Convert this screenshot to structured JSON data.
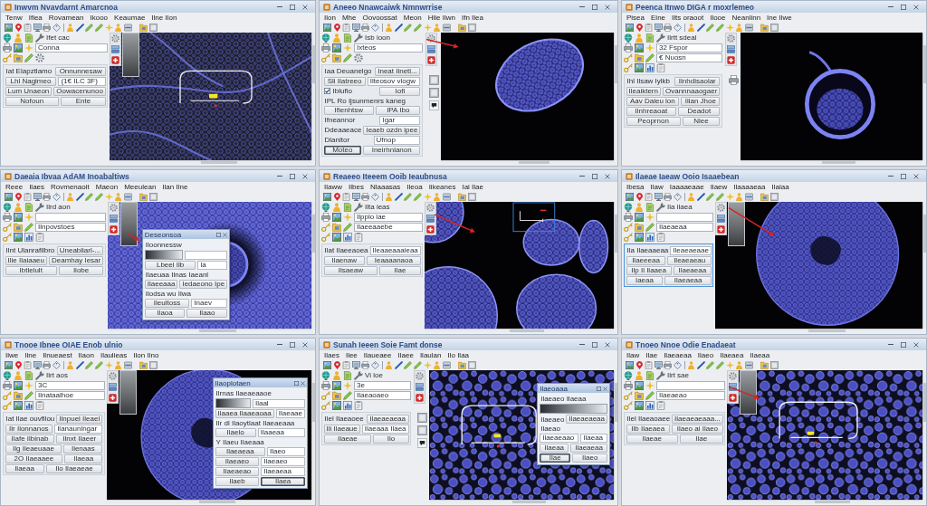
{
  "panels": [
    {
      "title": "Inwvm Nvavdarnt Amarcnoa",
      "menu": [
        "Tenw",
        "Ifiea",
        "Rovamean",
        "Ikooo",
        "Keaumae",
        "Ilne Ilon"
      ],
      "palette": [
        {
          "kind": "label",
          "text": "Ifet cac"
        },
        {
          "kind": "field",
          "value": "Conna"
        },
        {
          "kind": "plain"
        }
      ],
      "side": {
        "highlighted": false,
        "rows": [
          {
            "cells": [
              {
                "kind": "label",
                "text": "Iat Elapztlamo"
              },
              {
                "kind": "button",
                "text": "Onnunnesaw"
              }
            ]
          },
          {
            "cells": [
              {
                "kind": "button",
                "text": "Lhl Nagimeo"
              },
              {
                "kind": "field",
                "value": "(1€ ILC 3F)"
              }
            ]
          },
          {
            "cells": [
              {
                "kind": "button",
                "text": "Lum Unaeon"
              },
              {
                "kind": "button",
                "text": "Oowacenunoo"
              }
            ]
          },
          {
            "cells": [
              {
                "kind": "button",
                "text": "Nofoun"
              },
              {
                "kind": "button",
                "text": "Ente"
              }
            ]
          }
        ]
      }
    },
    {
      "title": "Aneeo Nnawcaiwk Nmnwrrise",
      "menu": [
        "Ilon",
        "Mhe",
        "Oovoossat",
        "Meon",
        "Hlie Ilwn",
        "Ifn Ilea"
      ],
      "palette": [
        {
          "kind": "label",
          "text": "Isb ioon"
        },
        {
          "kind": "field",
          "value": "Ixteos"
        },
        {
          "kind": "plain"
        }
      ],
      "side": {
        "highlighted": false,
        "rows": [
          {
            "cells": [
              {
                "kind": "label",
                "text": "Iaa Deuanelgo"
              },
              {
                "kind": "button",
                "text": "Ineat Ilnetl..."
              }
            ]
          },
          {
            "cells": [
              {
                "kind": "button",
                "text": "Sli Ilatreeo"
              },
              {
                "kind": "field",
                "value": "Ilteosov vlogw"
              }
            ]
          },
          {
            "cells": [
              {
                "kind": "check",
                "text": "Iblufio",
                "checked": true
              },
              {
                "kind": "button",
                "text": "Iofi"
              }
            ]
          },
          {
            "cells": [
              {
                "kind": "header",
                "text": "IPL Ro Ijsunmenrs kaneg"
              }
            ]
          },
          {
            "cells": [
              {
                "kind": "button",
                "text": "Ifienhtsw"
              },
              {
                "kind": "button",
                "text": "IPA Ibo"
              }
            ]
          },
          {
            "cells": [
              {
                "kind": "label",
                "text": "Ifneannor"
              },
              {
                "kind": "field",
                "value": "Igar"
              }
            ]
          },
          {
            "cells": [
              {
                "kind": "label",
                "text": "Ddeaaeace"
              },
              {
                "kind": "button",
                "text": "Ieaeb ozdn ipee"
              }
            ]
          },
          {
            "cells": [
              {
                "kind": "label",
                "text": "Dlanitor"
              },
              {
                "kind": "field",
                "value": "Ufnop"
              }
            ]
          },
          {
            "cells": [
              {
                "kind": "primary",
                "text": "Moteo"
              },
              {
                "kind": "button",
                "text": "Ineirhnlanon"
              }
            ]
          }
        ]
      }
    },
    {
      "title": "Peenca Itnwo DIGA r moxrlemeo",
      "menu": [
        "Pisea",
        "Eine",
        "Ilts oraoot",
        "Ilooe",
        "Neanlinn",
        "Ine Ilwe"
      ],
      "palette": [
        {
          "kind": "label",
          "text": "Ilrtt sdeal"
        },
        {
          "kind": "field",
          "value": "32 Fspor"
        },
        {
          "kind": "field",
          "value": "€ Nuosn"
        },
        {
          "kind": "plain"
        }
      ],
      "side": {
        "highlighted": false,
        "rows": [
          {
            "cells": [
              {
                "kind": "label",
                "text": "Ihl Ilsaw Iylkb"
              },
              {
                "kind": "button",
                "text": "Ilnhdisaolar"
              }
            ]
          },
          {
            "cells": [
              {
                "kind": "button",
                "text": "Ileaiktern"
              },
              {
                "kind": "button",
                "text": "Ovannnaaogaer"
              }
            ]
          },
          {
            "cells": [
              {
                "kind": "button",
                "text": "Aav Daleu lon"
              },
              {
                "kind": "button",
                "text": "Ilian Jhoe"
              }
            ]
          },
          {
            "cells": [
              {
                "kind": "button",
                "text": "Ilnhreaoat"
              },
              {
                "kind": "button",
                "text": "Deadot"
              }
            ]
          },
          {
            "cells": [
              {
                "kind": "button",
                "text": "Peoprnon"
              },
              {
                "kind": "button",
                "text": "Nlee"
              }
            ]
          }
        ]
      }
    },
    {
      "title": "Daeaia Ibvaa AdAM Inoabaltiws",
      "menu": [
        "Reee",
        "Ilaes",
        "Rovmenaoit",
        "Maeon",
        "Meeulean",
        "Ilan Ilne"
      ],
      "palette": [
        {
          "kind": "label",
          "text": "Ilrd aon"
        },
        {
          "kind": "field"
        },
        {
          "kind": "field",
          "value": "Ilnpovstoes"
        },
        {
          "kind": "plain"
        }
      ],
      "side": {
        "highlighted": false,
        "rows": [
          {
            "cells": [
              {
                "kind": "label",
                "text": "Ilnt Ulanrafilbro"
              },
              {
                "kind": "button",
                "text": "Uneabliarl-..."
              }
            ]
          },
          {
            "cells": [
              {
                "kind": "button",
                "text": "Ilie Ilaiaaeu"
              },
              {
                "kind": "button",
                "text": "Deamhay Iesar"
              }
            ]
          },
          {
            "cells": [
              {
                "kind": "button",
                "text": "Ibtlelult"
              },
              {
                "kind": "button",
                "text": "Ilobe"
              }
            ]
          }
        ]
      },
      "dialog": {
        "title": "Deseonsoa",
        "rows": [
          {
            "cells": [
              {
                "kind": "label",
                "text": "Iloonnessw"
              }
            ]
          },
          {
            "cells": [
              {
                "kind": "preview"
              },
              {
                "kind": "field"
              }
            ]
          },
          {
            "cells": [
              {
                "kind": "button",
                "text": "Lbeel Ilb"
              },
              {
                "kind": "field",
                "value": "la"
              }
            ]
          },
          {
            "cells": [
              {
                "kind": "label",
                "text": "Ilaeuaa Ilnas Iaeanl"
              }
            ]
          },
          {
            "cells": [
              {
                "kind": "button",
                "text": "Ilaeeaaa"
              },
              {
                "kind": "button",
                "text": "Iedaeono Ipe"
              }
            ]
          },
          {
            "cells": [
              {
                "kind": "label",
                "text": "Ilodsa wu Ilwa"
              }
            ]
          },
          {
            "cells": [
              {
                "kind": "button",
                "text": "Ileultoss"
              },
              {
                "kind": "field",
                "value": "Inaev"
              }
            ]
          },
          {
            "cells": [
              {
                "kind": "button",
                "text": "Ilaoa"
              },
              {
                "kind": "button",
                "text": "Ilaao"
              }
            ]
          }
        ]
      }
    },
    {
      "title": "Reaeeo Iteeem Ooib Ieaubnusa",
      "menu": [
        "Ilaww",
        "Ilbes",
        "Nlaaasas",
        "Ileoa",
        "Iikeanes",
        "Iai Ilae"
      ],
      "palette": [
        {
          "kind": "label",
          "text": "Ilta ieas"
        },
        {
          "kind": "field",
          "value": "Ilpplo lae"
        },
        {
          "kind": "field",
          "value": "Ilaeeaaebe"
        },
        {
          "kind": "plain"
        }
      ],
      "side": {
        "highlighted": false,
        "rows": [
          {
            "cells": [
              {
                "kind": "label",
                "text": "Ilat Ilaeeaoea"
              },
              {
                "kind": "field",
                "value": "Ileaaeaaaieaa"
              }
            ]
          },
          {
            "cells": [
              {
                "kind": "button",
                "text": "Ilaenaw"
              },
              {
                "kind": "button",
                "text": "Ieaaaanaoa"
              }
            ]
          },
          {
            "cells": [
              {
                "kind": "button",
                "text": "Ilsaeaw"
              },
              {
                "kind": "button",
                "text": "Ilae"
              }
            ]
          }
        ]
      }
    },
    {
      "title": "Ilaeae Iaeaw Ooio Isaaebean",
      "menu": [
        "Ibesa",
        "Ilaw",
        "Iaaaaeaae",
        "Ilaew",
        "Ilaaaaeaa",
        "Ilaiaa"
      ],
      "palette": [
        {
          "kind": "label",
          "text": "Ila ilaea"
        },
        {
          "kind": "field"
        },
        {
          "kind": "field",
          "value": "Ilaeaeaa"
        },
        {
          "kind": "plain"
        }
      ],
      "side": {
        "highlighted": true,
        "rows": [
          {
            "cells": [
              {
                "kind": "label",
                "text": "Ila Ilaeaaeaa"
              },
              {
                "kind": "field",
                "value": "Ileaeaeaae"
              }
            ]
          },
          {
            "cells": [
              {
                "kind": "button",
                "text": "Ilaeeeaa"
              },
              {
                "kind": "button",
                "text": "Ileaeaeau"
              }
            ]
          },
          {
            "cells": [
              {
                "kind": "button",
                "text": "Ilp Il Ilaaea"
              },
              {
                "kind": "button",
                "text": "Ilaeaeaa"
              }
            ]
          },
          {
            "cells": [
              {
                "kind": "button",
                "text": "Iaeaa"
              },
              {
                "kind": "button",
                "text": "Ilaeaeaa"
              }
            ]
          }
        ]
      }
    },
    {
      "title": "Tnooe Ibnee OIAE Enob ulnio",
      "menu": [
        "Ilwe",
        "Ilne",
        "Ilnueaest",
        "Ilaon",
        "Ilaulieas",
        "Ilon Ilno"
      ],
      "palette": [
        {
          "kind": "label",
          "text": "Ilrt aos"
        },
        {
          "kind": "field",
          "value": "3C"
        },
        {
          "kind": "field",
          "value": "Ilnataalhoe"
        },
        {
          "kind": "plain"
        }
      ],
      "side": {
        "highlighted": false,
        "rows": [
          {
            "cells": [
              {
                "kind": "label",
                "text": "Iat Ilae ouvfilou"
              },
              {
                "kind": "button",
                "text": "Ilnpuel Ileael"
              }
            ]
          },
          {
            "cells": [
              {
                "kind": "button",
                "text": "Ilr Ilonnanos"
              },
              {
                "kind": "field",
                "value": "Ilanaunlngar"
              }
            ]
          },
          {
            "cells": [
              {
                "kind": "button",
                "text": "Ilafe Ilbinab"
              },
              {
                "kind": "button",
                "text": "Ilnxt Ilaeer"
              }
            ]
          },
          {
            "cells": [
              {
                "kind": "button",
                "text": "Ilg Ileaeuaae"
              },
              {
                "kind": "button",
                "text": "Ilenaas"
              }
            ]
          },
          {
            "cells": [
              {
                "kind": "button",
                "text": "2O Ilaeaaee"
              },
              {
                "kind": "button",
                "text": "Ilaeaa"
              }
            ]
          },
          {
            "cells": [
              {
                "kind": "button",
                "text": "Ilaeaa"
              },
              {
                "kind": "button",
                "text": "Ilo Ilaeaeae"
              }
            ]
          }
        ]
      },
      "dialog": {
        "title": "Ilaoplotaen",
        "rows": [
          {
            "cells": [
              {
                "kind": "label",
                "text": "Ilrnas Ilaeaeaaoe"
              }
            ]
          },
          {
            "cells": [
              {
                "kind": "preview"
              },
              {
                "kind": "field",
                "value": "Ilaal"
              }
            ]
          },
          {
            "cells": [
              {
                "kind": "button",
                "text": "Ilaaea Ilaaeaoaa"
              },
              {
                "kind": "field",
                "value": "Ilaeaae"
              }
            ]
          },
          {
            "cells": [
              {
                "kind": "label",
                "text": "Ilr dl Ilaoytlaat Ilaeaeaaa"
              }
            ]
          },
          {
            "cells": [
              {
                "kind": "button",
                "text": "Ilaelo"
              },
              {
                "kind": "field",
                "value": "Ilaaeaa"
              }
            ]
          },
          {
            "cells": [
              {
                "kind": "label",
                "text": "Y Ilaeu Ilaeaaa"
              }
            ]
          },
          {
            "cells": [
              {
                "kind": "button",
                "text": "Ilaeaeaa"
              },
              {
                "kind": "field",
                "value": "Ilaeo"
              }
            ]
          },
          {
            "cells": [
              {
                "kind": "button",
                "text": "Ilaeaeo"
              },
              {
                "kind": "field",
                "value": "Ilaeaeo"
              }
            ]
          },
          {
            "cells": [
              {
                "kind": "button",
                "text": "Ilaeaeao"
              },
              {
                "kind": "field",
                "value": "Ilaeaeaa"
              }
            ]
          },
          {
            "cells": [
              {
                "kind": "button",
                "text": "Ilaeb"
              },
              {
                "kind": "primary",
                "text": "Ilaea"
              }
            ]
          }
        ]
      }
    },
    {
      "title": "Sunah Ieeen Soie Famt donse",
      "menu": [
        "Ilaes",
        "Ilee",
        "Ilaueaee",
        "Ilaee",
        "Ilaulan",
        "Ilo Ilaa"
      ],
      "palette": [
        {
          "kind": "label",
          "text": "Vi loe"
        },
        {
          "kind": "field",
          "value": "3e"
        },
        {
          "kind": "field",
          "value": "Ilaeaoaeo"
        },
        {
          "kind": "plain"
        }
      ],
      "side": {
        "highlighted": false,
        "rows": [
          {
            "cells": [
              {
                "kind": "label",
                "text": "Ilel Ilaeaoee"
              },
              {
                "kind": "button",
                "text": "Ilaeaeaeaa"
              }
            ]
          },
          {
            "cells": [
              {
                "kind": "button",
                "text": "Ili Ilaeaue"
              },
              {
                "kind": "field",
                "value": "Ilaeaaa Ilaea"
              }
            ]
          },
          {
            "cells": [
              {
                "kind": "button",
                "text": "Ilaeae"
              },
              {
                "kind": "button",
                "text": "Ilo"
              }
            ]
          }
        ]
      },
      "dialog": {
        "title": "Ilaeoaaa",
        "rows": [
          {
            "cells": [
              {
                "kind": "label",
                "text": "Ilaeaeo Ilaeaa"
              }
            ]
          },
          {
            "cells": [
              {
                "kind": "preview"
              }
            ]
          },
          {
            "cells": [
              {
                "kind": "label",
                "text": "Ilaeaeo"
              },
              {
                "kind": "button",
                "text": "Ilaeaeaeaa"
              }
            ]
          },
          {
            "cells": [
              {
                "kind": "label",
                "text": "Ilaeao"
              }
            ]
          },
          {
            "cells": [
              {
                "kind": "field",
                "value": "Ilaeaeaao"
              },
              {
                "kind": "field",
                "value": "Ilaeaa"
              }
            ]
          },
          {
            "cells": [
              {
                "kind": "button",
                "text": "Ilaeaa"
              },
              {
                "kind": "button",
                "text": "Ilaeaeaa"
              }
            ]
          },
          {
            "cells": [
              {
                "kind": "primary",
                "text": "Ilae"
              },
              {
                "kind": "button",
                "text": "Ilaeo"
              }
            ]
          }
        ]
      }
    },
    {
      "title": "Tnoeo Nnoe Odie Enadaeat",
      "menu": [
        "Ilaw",
        "Ilae",
        "Ilaeaeaa",
        "Ilaeo",
        "Ilaeaea",
        "Ilaeaa"
      ],
      "palette": [
        {
          "kind": "label",
          "text": "Ilrt sae"
        },
        {
          "kind": "field"
        },
        {
          "kind": "field",
          "value": "Ilaeaeao"
        },
        {
          "kind": "plain"
        }
      ],
      "side": {
        "highlighted": false,
        "rows": [
          {
            "cells": [
              {
                "kind": "label",
                "text": "Ilel Ilaeaoaee"
              },
              {
                "kind": "button",
                "text": "Ilaeaeaeaaa..."
              }
            ]
          },
          {
            "cells": [
              {
                "kind": "button",
                "text": "Ilb Ilaeaea"
              },
              {
                "kind": "button",
                "text": "Ilaeo ai Ilaeo"
              }
            ]
          },
          {
            "cells": [
              {
                "kind": "button",
                "text": "Ilaeae"
              },
              {
                "kind": "button",
                "text": "Ilae"
              }
            ]
          }
        ]
      }
    }
  ]
}
